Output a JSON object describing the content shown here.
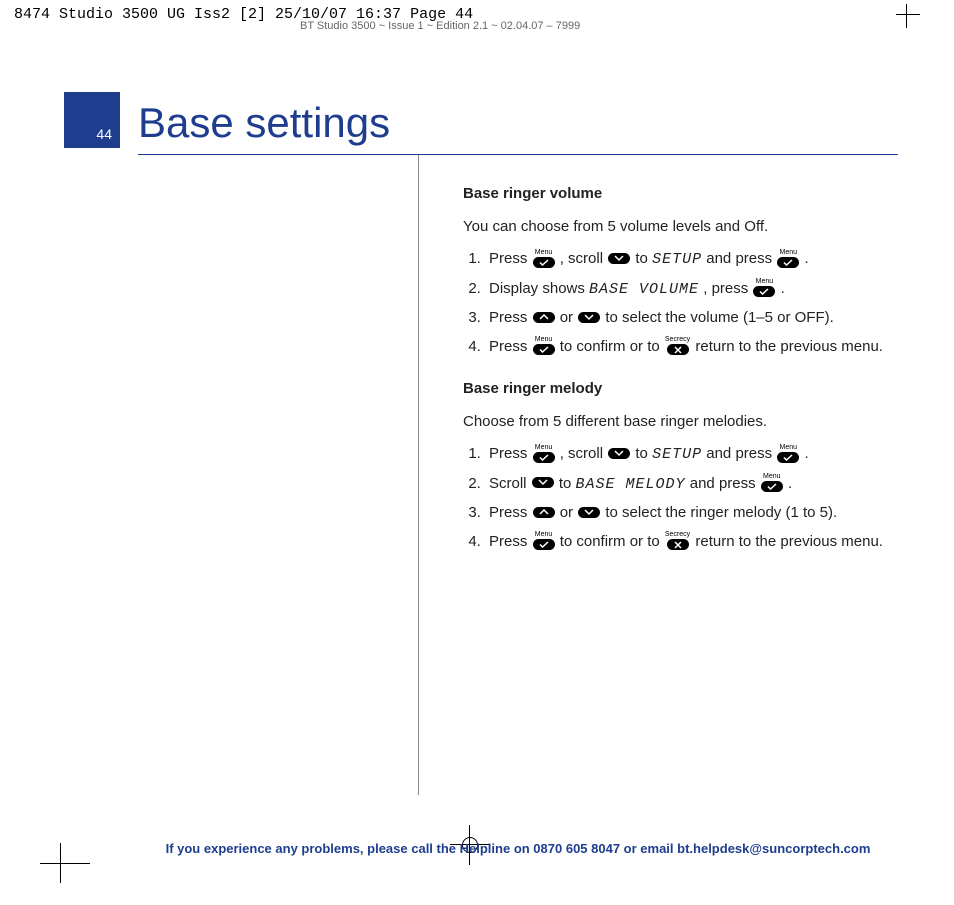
{
  "slug1": "8474 Studio 3500 UG Iss2 [2]  25/10/07  16:37  Page 44",
  "slug2": "BT Studio 3500 ~ Issue 1 ~ Edition 2.1 ~ 02.04.07 – 7999",
  "page_number": "44",
  "title": "Base settings",
  "icons": {
    "menu_label": "Menu",
    "secrecy_label": "Secrecy"
  },
  "lcd": {
    "setup": "SETUP",
    "base_volume": "BASE VOLUME",
    "base_melody": "BASE MELODY"
  },
  "section1": {
    "title": "Base ringer volume",
    "intro": "You can choose from 5 volume levels and Off.",
    "s1a": "Press ",
    "s1b": ", scroll ",
    "s1c": " to ",
    "s1d": " and press ",
    "s1e": ".",
    "s2a": "Display shows ",
    "s2b": ", press ",
    "s2c": ".",
    "s3a": "Press ",
    "s3b": " or ",
    "s3c": " to select the volume (1–5 or OFF).",
    "s4a": "Press ",
    "s4b": " to confirm or to ",
    "s4c": " return to the previous menu."
  },
  "section2": {
    "title": "Base ringer melody",
    "intro": "Choose from 5 different base ringer melodies.",
    "s1a": "Press ",
    "s1b": ", scroll ",
    "s1c": " to ",
    "s1d": " and press ",
    "s1e": ".",
    "s2a": "Scroll ",
    "s2b": " to ",
    "s2c": " and press ",
    "s2d": ".",
    "s3a": "Press ",
    "s3b": " or ",
    "s3c": " to select the ringer melody (1 to 5).",
    "s4a": "Press ",
    "s4b": " to confirm or to ",
    "s4c": " return to the previous menu."
  },
  "footer": "If you experience any problems, please call the Helpline on 0870 605 8047 or email bt.helpdesk@suncorptech.com"
}
